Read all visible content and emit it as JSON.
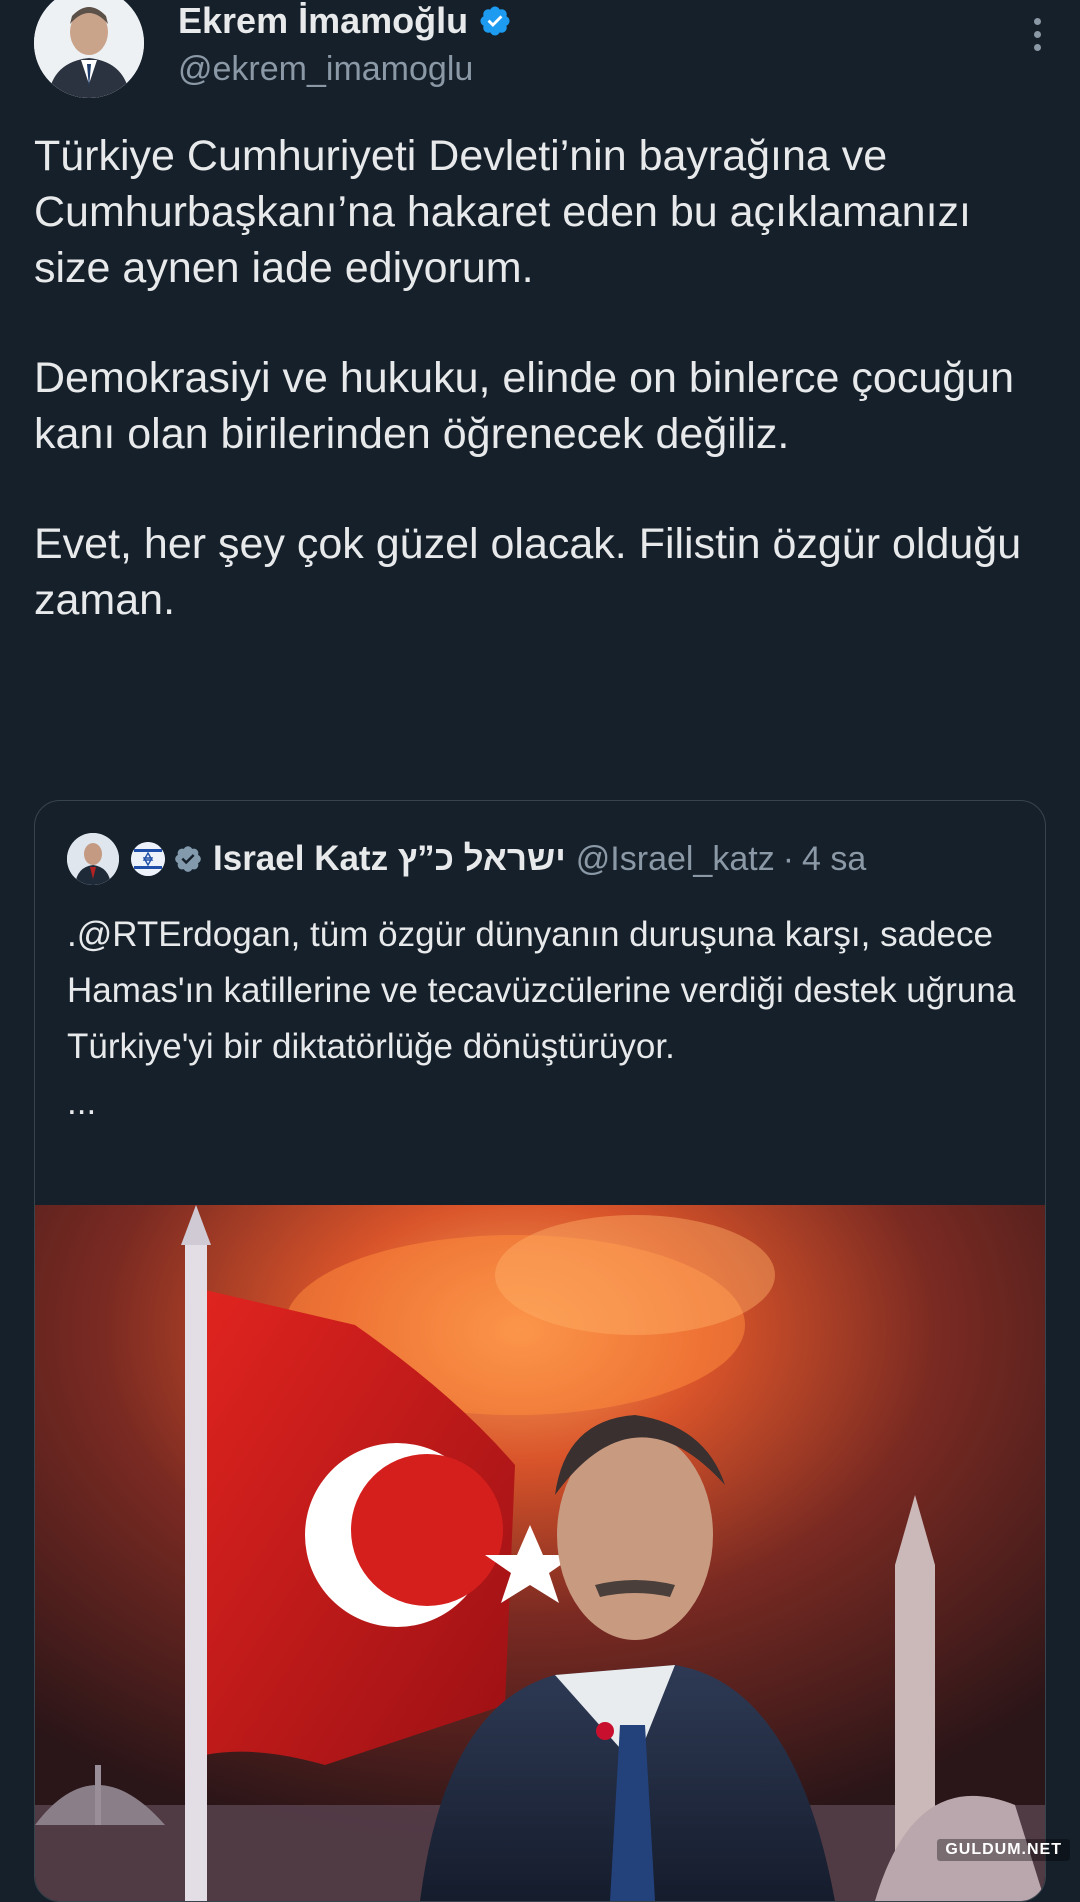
{
  "author": {
    "display_name": "Ekrem İmamoğlu",
    "handle": "@ekrem_imamoglu",
    "avatar_icon": "user-avatar",
    "verified_icon": "verified-badge-icon"
  },
  "tweet": {
    "paragraphs": [
      "Türkiye Cumhuriyeti Devleti’nin bayrağına ve Cumhurbaşkanı’na hakaret eden bu açıklamanızı size aynen iade ediyorum.",
      "Demokrasiyi ve hukuku, elinde on binlerce çocuğun kanı olan birilerinden öğrenecek değiliz.",
      "Evet, her şey çok güzel olacak. Filistin özgür olduğu zaman."
    ]
  },
  "quoted_tweet": {
    "display_name": "Israel Katz ישראל כ”ץ",
    "handle": "@Israel_katz",
    "time": "4 sa",
    "separator": "·",
    "text": ".@RTErdogan, tüm özgür dünyanın duruşuna karşı, sadece Hamas'ın katillerine ve tecavüzcülerine verdiği destek uğruna Türkiye'yi bir diktatörlüğe dönüştürüyor.",
    "ellipsis": "...",
    "media_description_icon": "quoted-media-image"
  },
  "watermark": "GULDUM.NET",
  "colors": {
    "background": "#15202b",
    "text": "#e7e9ea",
    "muted": "#8b98a5",
    "verified_blue": "#1d9bf0",
    "border": "#38444d"
  }
}
